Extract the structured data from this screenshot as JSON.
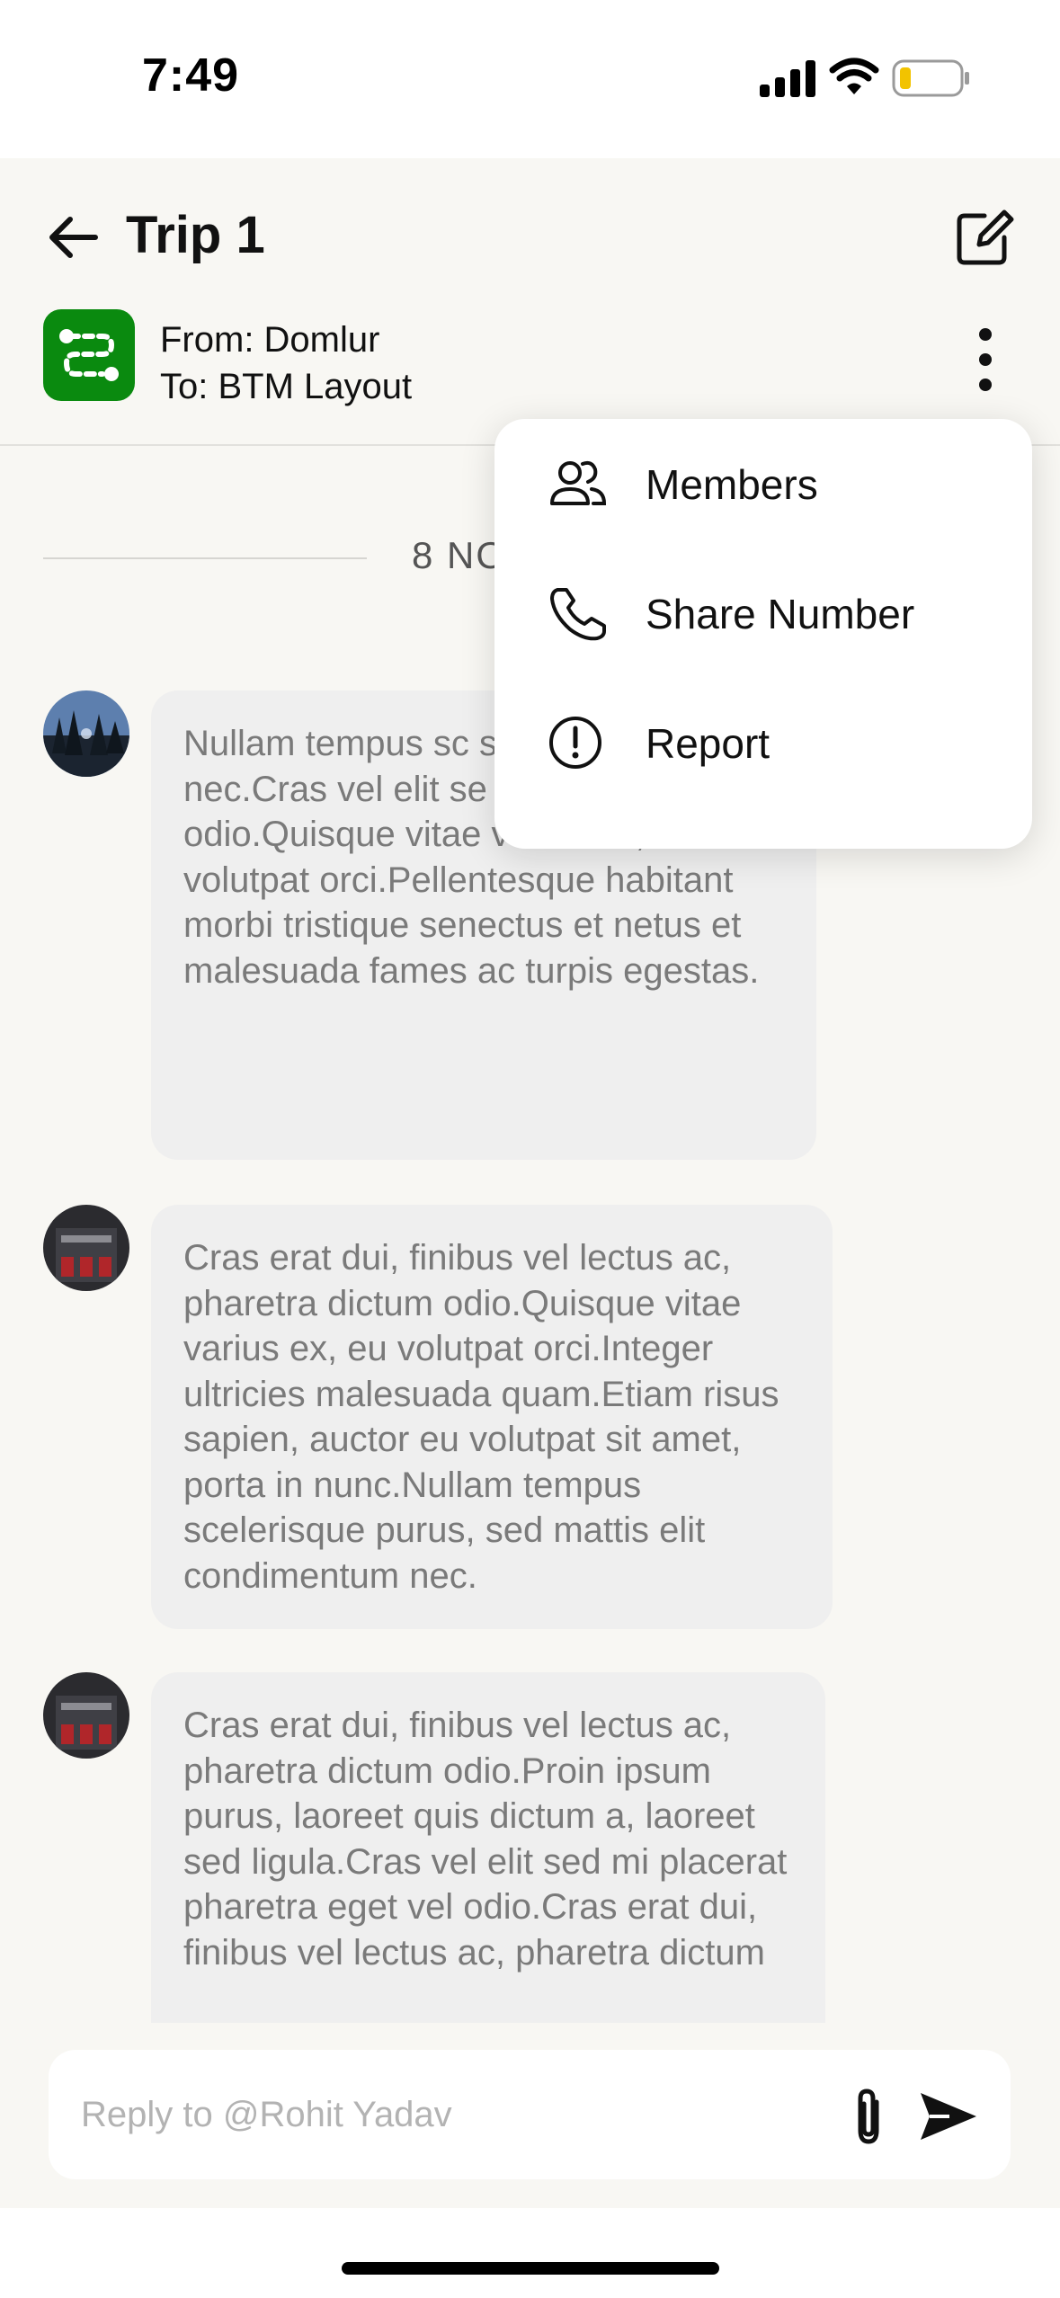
{
  "status_bar": {
    "time": "7:49"
  },
  "header": {
    "title": "Trip 1",
    "route_from": "From: Domlur",
    "route_to": "To: BTM Layout"
  },
  "date_separator": "8 NO",
  "messages": [
    {
      "avatar": "forest-avatar",
      "text": "Nullam tempus sc sed mattis elit cor nec.Cras vel elit se pharetra eget vel odio.Quisque vitae varius ex, eu volutpat orci.Pellentesque habitant morbi tristique senectus et netus et malesuada fames ac turpis egestas."
    },
    {
      "avatar": "building-avatar",
      "text": "Cras erat dui, finibus vel lectus ac, pharetra dictum odio.Quisque vitae varius ex, eu volutpat orci.Integer ultricies malesuada quam.Etiam risus sapien, auctor eu volutpat sit amet, porta in nunc.Nullam tempus scelerisque purus, sed mattis elit condimentum nec."
    },
    {
      "avatar": "building-avatar",
      "text": "Cras erat dui, finibus vel lectus ac, pharetra dictum odio.Proin ipsum purus, laoreet quis dictum a, laoreet sed ligula.Cras vel elit sed mi placerat pharetra eget vel odio.Cras erat dui, finibus vel lectus ac, pharetra dictum"
    }
  ],
  "composer": {
    "placeholder": "Reply to @Rohit Yadav"
  },
  "menu": {
    "items": [
      {
        "label": "Members",
        "icon": "members-icon"
      },
      {
        "label": "Share Number",
        "icon": "phone-icon"
      },
      {
        "label": "Report",
        "icon": "report-icon"
      }
    ]
  },
  "colors": {
    "brand": "#0a8a0f",
    "background": "#f8f7f3",
    "bubble": "#efefef"
  }
}
